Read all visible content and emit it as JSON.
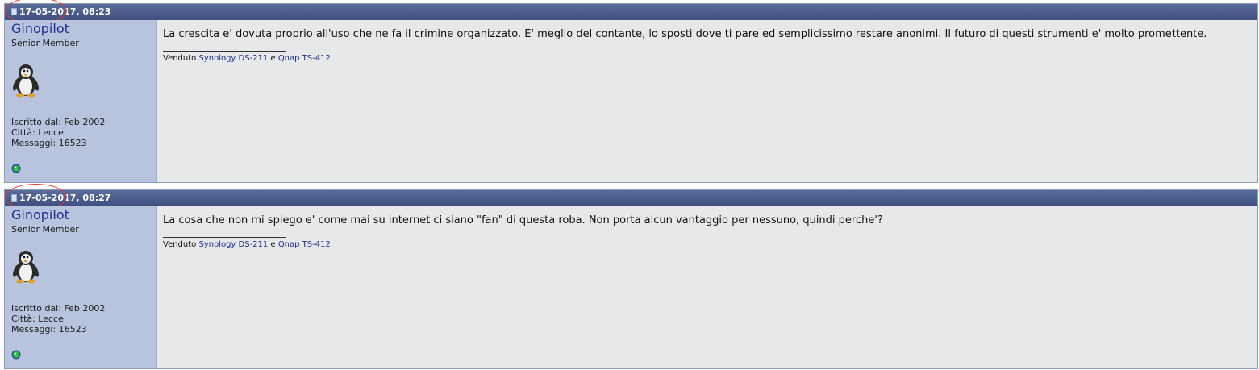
{
  "posts": [
    {
      "date": "17-05-2017",
      "time": "08:23",
      "username": "Ginopilot",
      "user_title": "Senior Member",
      "joined": "Iscritto dal: Feb 2002",
      "city": "Città: Lecce",
      "messages": "Messaggi: 16523",
      "message": "La crescita e' dovuta proprio all'uso che ne fa il crimine organizzato. E' meglio del contante, lo sposti dove ti pare ed semplicissimo restare anonimi. Il futuro di questi strumenti e' molto promettente.",
      "signature": {
        "prefix": "Venduto",
        "link1": "Synology DS-211",
        "conj": "e",
        "link2": "Qnap TS-412"
      },
      "online_status_color": "#2fbf3a"
    },
    {
      "date": "17-05-2017",
      "time": "08:27",
      "username": "Ginopilot",
      "user_title": "Senior Member",
      "joined": "Iscritto dal: Feb 2002",
      "city": "Città: Lecce",
      "messages": "Messaggi: 16523",
      "message": "La cosa che non mi spiego e' come mai su internet ci siano \"fan\" di questa roba. Non porta alcun vantaggio per nessuno, quindi perche'?",
      "signature": {
        "prefix": "Venduto",
        "link1": "Synology DS-211",
        "conj": "e",
        "link2": "Qnap TS-412"
      },
      "online_status_color": "#2fbf3a"
    }
  ],
  "colors": {
    "header_bar": "#4a5b8c",
    "sidebar_bg": "#b8c4dd",
    "body_bg": "#e7e8ea",
    "link": "#1f2f8f",
    "annotation_circle": "#e03a33"
  },
  "icons": {
    "post_icon": "post-icon",
    "avatar": "penguin-avatar-icon",
    "online_status": "online-status-icon"
  }
}
